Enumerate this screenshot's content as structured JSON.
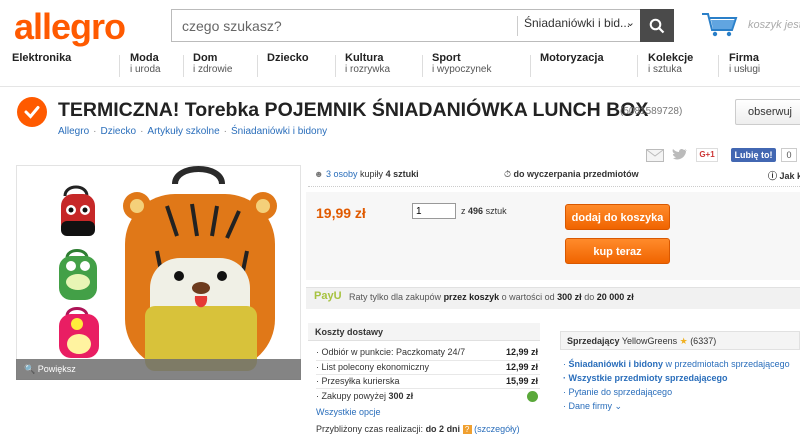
{
  "header": {
    "logo": "allegro",
    "search_placeholder": "czego szukasz?",
    "search_category": "Śniadaniówki i bid...",
    "cart_text": "koszyk jest p"
  },
  "nav": [
    {
      "label": "Elektronika",
      "sub": ""
    },
    {
      "label": "Moda",
      "sub": "i uroda"
    },
    {
      "label": "Dom",
      "sub": "i zdrowie"
    },
    {
      "label": "Dziecko",
      "sub": ""
    },
    {
      "label": "Kultura",
      "sub": "i rozrywka"
    },
    {
      "label": "Sport",
      "sub": "i wypoczynek"
    },
    {
      "label": "Motoryzacja",
      "sub": ""
    },
    {
      "label": "Kolekcje",
      "sub": "i sztuka"
    },
    {
      "label": "Firma",
      "sub": "i usługi"
    }
  ],
  "product": {
    "title": "TERMICZNA! Torebka POJEMNIK ŚNIADANIÓWKA LUNCH BOX",
    "id": "(5081589728)",
    "observe_label": "obserwuj",
    "breadcrumbs": [
      "Allegro",
      "Dziecko",
      "Artykuły szkolne",
      "Śniadaniówki i bidony"
    ],
    "zoom_label": "Powiększ"
  },
  "social": {
    "gplus": "G+1",
    "fb_like": "Lubię to!",
    "fb_count": "0"
  },
  "info": {
    "buyers_count": "3 osoby",
    "buyers_text": "kupiły",
    "buyers_items": "4 sztuki",
    "until": "do wyczerpania przedmiotów",
    "howto": "Jak k"
  },
  "buy": {
    "price": "19,99 zł",
    "qty": "1",
    "qty_of": "z",
    "qty_total": "496",
    "qty_unit": "sztuk",
    "add_to_cart": "dodaj do koszyka",
    "buy_now": "kup teraz"
  },
  "payu": {
    "logo": "PayU",
    "text_a": "Raty tylko dla zakupów",
    "text_b": "przez koszyk",
    "text_c": "o wartości od",
    "min": "300 zł",
    "text_d": "do",
    "max": "20 000 zł"
  },
  "shipping": {
    "title": "Koszty dostawy",
    "rows": [
      {
        "label": "Odbiór w punkcie: Paczkomaty 24/7",
        "value": "12,99 zł"
      },
      {
        "label": "List polecony ekonomiczny",
        "value": "12,99 zł"
      },
      {
        "label": "Przesyłka kurierska",
        "value": "15,99 zł"
      },
      {
        "label": "Zakupy powyżej",
        "value": "300 zł"
      }
    ],
    "more_options": "Wszystkie opcje",
    "realization_label": "Przybliżony czas realizacji:",
    "realization_value": "do 2 dni",
    "details": "(szczegóły)"
  },
  "seller": {
    "label": "Sprzedający",
    "name": "YellowGreens",
    "rating": "(6337)",
    "cat_link": "Śniadaniówki i bidony",
    "cat_suffix": "w przedmiotach sprzedającego",
    "all_items": "Wszystkie przedmioty sprzedającego",
    "ask": "Pytanie do sprzedającego",
    "other": "Dane firmy"
  },
  "colors": {
    "brand": "#ff5a00",
    "link": "#2a6ebb",
    "price": "#e05a00"
  }
}
